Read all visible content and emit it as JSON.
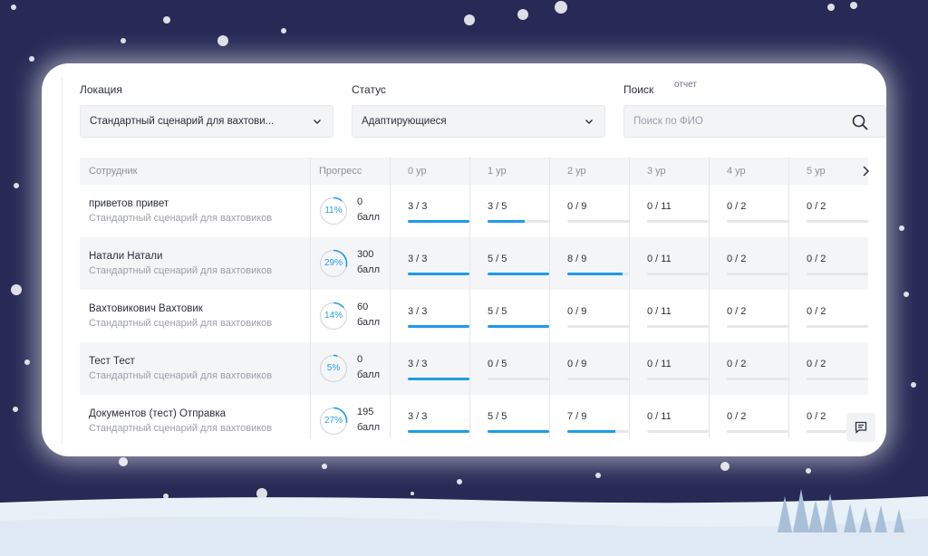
{
  "report_label": "отчет",
  "filters": {
    "location": {
      "label": "Локация",
      "value": "Стандартный сценарий для вахтови..."
    },
    "status": {
      "label": "Статус",
      "value": "Адаптирующиеся"
    },
    "search": {
      "label": "Поиск",
      "placeholder": "Поиск по ФИО"
    }
  },
  "table": {
    "headers": {
      "employee": "Сотрудник",
      "progress": "Прогресс"
    },
    "levels": [
      "0 ур",
      "1 ур",
      "2 ур",
      "3 ур",
      "4 ур",
      "5 ур"
    ],
    "rows": [
      {
        "name": "приветов привет",
        "scenario": "Стандартный сценарий для вахтовиков",
        "progress_label": "11%",
        "progress": 0.11,
        "score": "0",
        "score_unit": "балл",
        "levels": [
          {
            "text": "3 / 3",
            "fill": 1.0
          },
          {
            "text": "3 / 5",
            "fill": 0.6
          },
          {
            "text": "0 / 9",
            "fill": 0
          },
          {
            "text": "0 / 11",
            "fill": 0
          },
          {
            "text": "0 / 2",
            "fill": 0
          },
          {
            "text": "0 / 2",
            "fill": 0
          }
        ]
      },
      {
        "name": "Натали Натали",
        "scenario": "Стандартный сценарий для вахтовиков",
        "progress_label": "29%",
        "progress": 0.29,
        "score": "300",
        "score_unit": "балл",
        "levels": [
          {
            "text": "3 / 3",
            "fill": 1.0
          },
          {
            "text": "5 / 5",
            "fill": 1.0
          },
          {
            "text": "8 / 9",
            "fill": 0.89
          },
          {
            "text": "0 / 11",
            "fill": 0
          },
          {
            "text": "0 / 2",
            "fill": 0
          },
          {
            "text": "0 / 2",
            "fill": 0
          }
        ]
      },
      {
        "name": "Вахтовикович Вахтовик",
        "scenario": "Стандартный сценарий для вахтовиков",
        "progress_label": "14%",
        "progress": 0.14,
        "score": "60",
        "score_unit": "балл",
        "levels": [
          {
            "text": "3 / 3",
            "fill": 1.0
          },
          {
            "text": "5 / 5",
            "fill": 1.0
          },
          {
            "text": "0 / 9",
            "fill": 0
          },
          {
            "text": "0 / 11",
            "fill": 0
          },
          {
            "text": "0 / 2",
            "fill": 0
          },
          {
            "text": "0 / 2",
            "fill": 0
          }
        ]
      },
      {
        "name": "Тест Тест",
        "scenario": "Стандартный сценарий для вахтовиков",
        "progress_label": "5%",
        "progress": 0.05,
        "score": "0",
        "score_unit": "балл",
        "levels": [
          {
            "text": "3 / 3",
            "fill": 1.0
          },
          {
            "text": "0 / 5",
            "fill": 0
          },
          {
            "text": "0 / 9",
            "fill": 0
          },
          {
            "text": "0 / 11",
            "fill": 0
          },
          {
            "text": "0 / 2",
            "fill": 0
          },
          {
            "text": "0 / 2",
            "fill": 0
          }
        ]
      },
      {
        "name": "Документов (тест) Отправка",
        "scenario": "Стандартный сценарий для вахтовиков",
        "progress_label": "27%",
        "progress": 0.27,
        "score": "195",
        "score_unit": "балл",
        "levels": [
          {
            "text": "3 / 3",
            "fill": 1.0
          },
          {
            "text": "5 / 5",
            "fill": 1.0
          },
          {
            "text": "7 / 9",
            "fill": 0.78
          },
          {
            "text": "0 / 11",
            "fill": 0
          },
          {
            "text": "0 / 2",
            "fill": 0
          },
          {
            "text": "0 / 2",
            "fill": 0
          }
        ]
      }
    ]
  },
  "colors": {
    "accent": "#1f9be6",
    "background": "#262a55",
    "track": "#e5e7eb"
  },
  "icons": {
    "dropdown": "chevron-down-icon",
    "search": "search-icon",
    "next": "chevron-right-icon",
    "chat": "chat-icon"
  }
}
